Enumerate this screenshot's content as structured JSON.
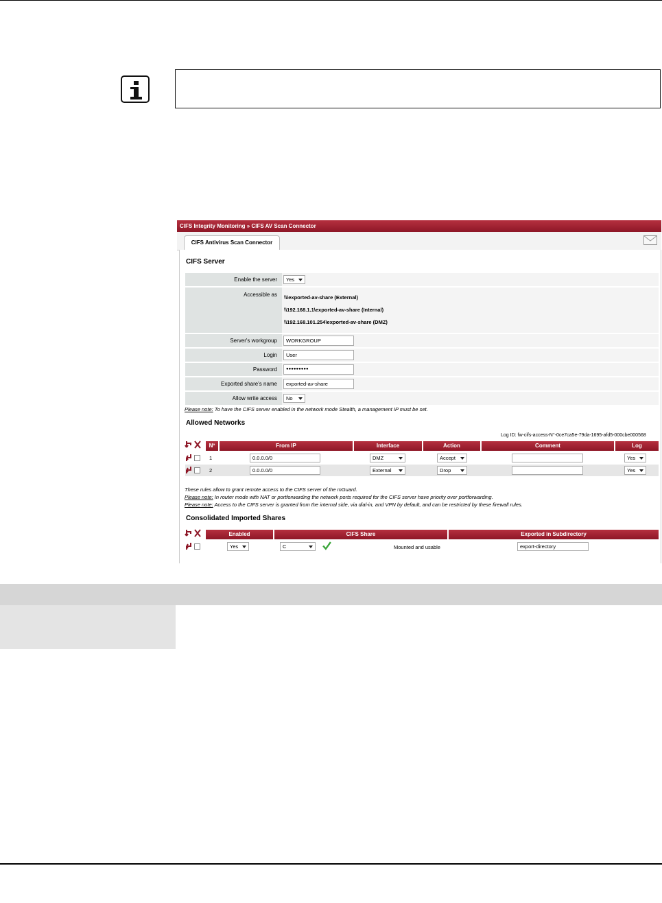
{
  "breadcrumb": "CIFS Integrity Monitoring » CIFS AV Scan Connector",
  "tab_label": "CIFS Antivirus Scan Connector",
  "cifs_server": {
    "title": "CIFS Server",
    "enable_label": "Enable the server",
    "enable_value": "Yes",
    "accessible_label": "Accessible as",
    "accessible_values": [
      "\\\\\\exported-av-share (External)",
      "\\\\192.168.1.1\\exported-av-share (Internal)",
      "\\\\192.168.101.254\\exported-av-share (DMZ)"
    ],
    "workgroup_label": "Server's workgroup",
    "workgroup_value": "WORKGROUP",
    "login_label": "Login",
    "login_value": "User",
    "password_label": "Password",
    "password_value": "●●●●●●●●●",
    "share_label": "Exported share's name",
    "share_value": "exported-av-share",
    "write_label": "Allow write access",
    "write_value": "No",
    "note_prefix": "Please note:",
    "note_text": " To have the CIFS server enabled in the network mode Stealth, a management IP must be set."
  },
  "allowed_networks": {
    "title": "Allowed Networks",
    "log_id": "Log ID: fw-cifs-access-N°-0ce7ca5e-79da-1695-afd5-000cbe000568",
    "headers": [
      "Nº",
      "From IP",
      "Interface",
      "Action",
      "Comment",
      "Log"
    ],
    "rows": [
      {
        "num": "1",
        "from_ip": "0.0.0.0/0",
        "interface": "DMZ",
        "action": "Accept",
        "comment": "",
        "log": "Yes"
      },
      {
        "num": "2",
        "from_ip": "0.0.0.0/0",
        "interface": "External",
        "action": "Drop",
        "comment": "",
        "log": "Yes"
      }
    ],
    "note1": "These rules allow to grant remote access to the CIFS server of the mGuard.",
    "note2_prefix": "Please note:",
    "note2_text": " In router mode with NAT or portforwarding the network ports required for the CIFS server have priority over portforwarding.",
    "note3_prefix": "Please note:",
    "note3_text": " Access to the CIFS server is granted from the internal side, via dial-in, and VPN by default, and can be restricted by these firewall rules."
  },
  "imported_shares": {
    "title": "Consolidated Imported Shares",
    "headers": [
      "Enabled",
      "CIFS Share",
      "Exported in Subdirectory"
    ],
    "rows": [
      {
        "enabled": "Yes",
        "share": "C",
        "status": "Mounted and usable",
        "subdir": "export-directory"
      }
    ]
  },
  "colors": {
    "accent": "#9e1f30",
    "row_bg": "#dfe3e2"
  }
}
